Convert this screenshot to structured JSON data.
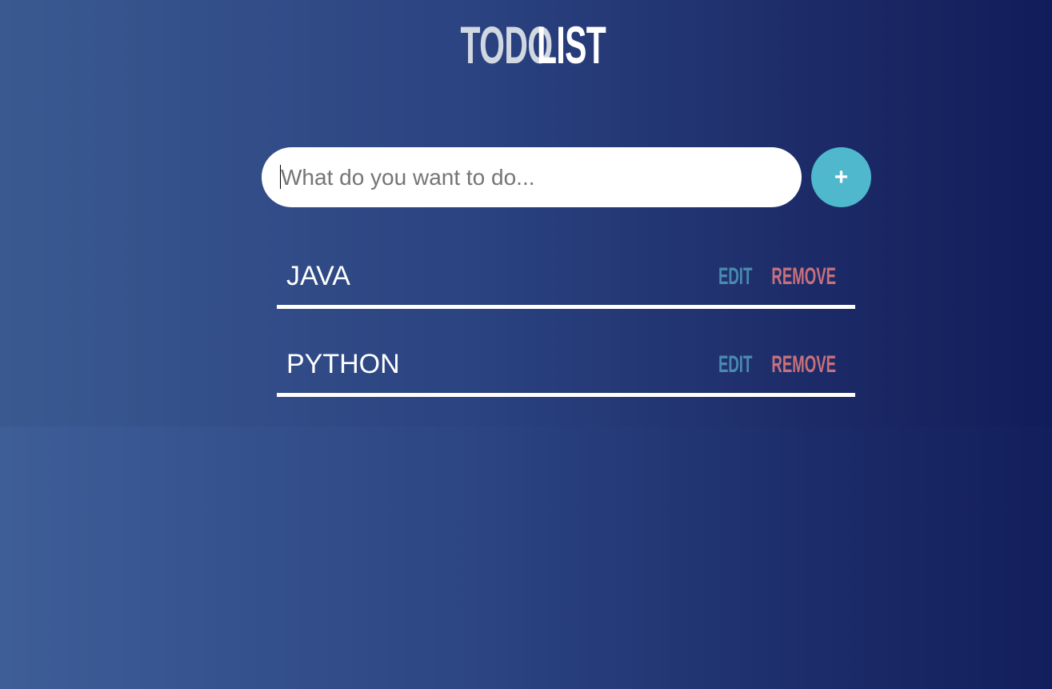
{
  "app": {
    "title_part1": "TODO",
    "title_part2": "LIST"
  },
  "form": {
    "input_value": "",
    "input_placeholder": "What do you want to do...",
    "add_button_label": "+"
  },
  "todos": [
    {
      "text": "JAVA",
      "edit_label": "EDIT",
      "remove_label": "REMOVE"
    },
    {
      "text": "PYTHON",
      "edit_label": "EDIT",
      "remove_label": "REMOVE"
    }
  ],
  "colors": {
    "background_start": "#3e5e98",
    "background_end": "#121f5c",
    "add_button": "#4fb8cd",
    "edit_text": "#4a8ab0",
    "remove_text": "#c8707c",
    "title_part1": "#d2d8e2",
    "title_part2": "#ffffff"
  }
}
